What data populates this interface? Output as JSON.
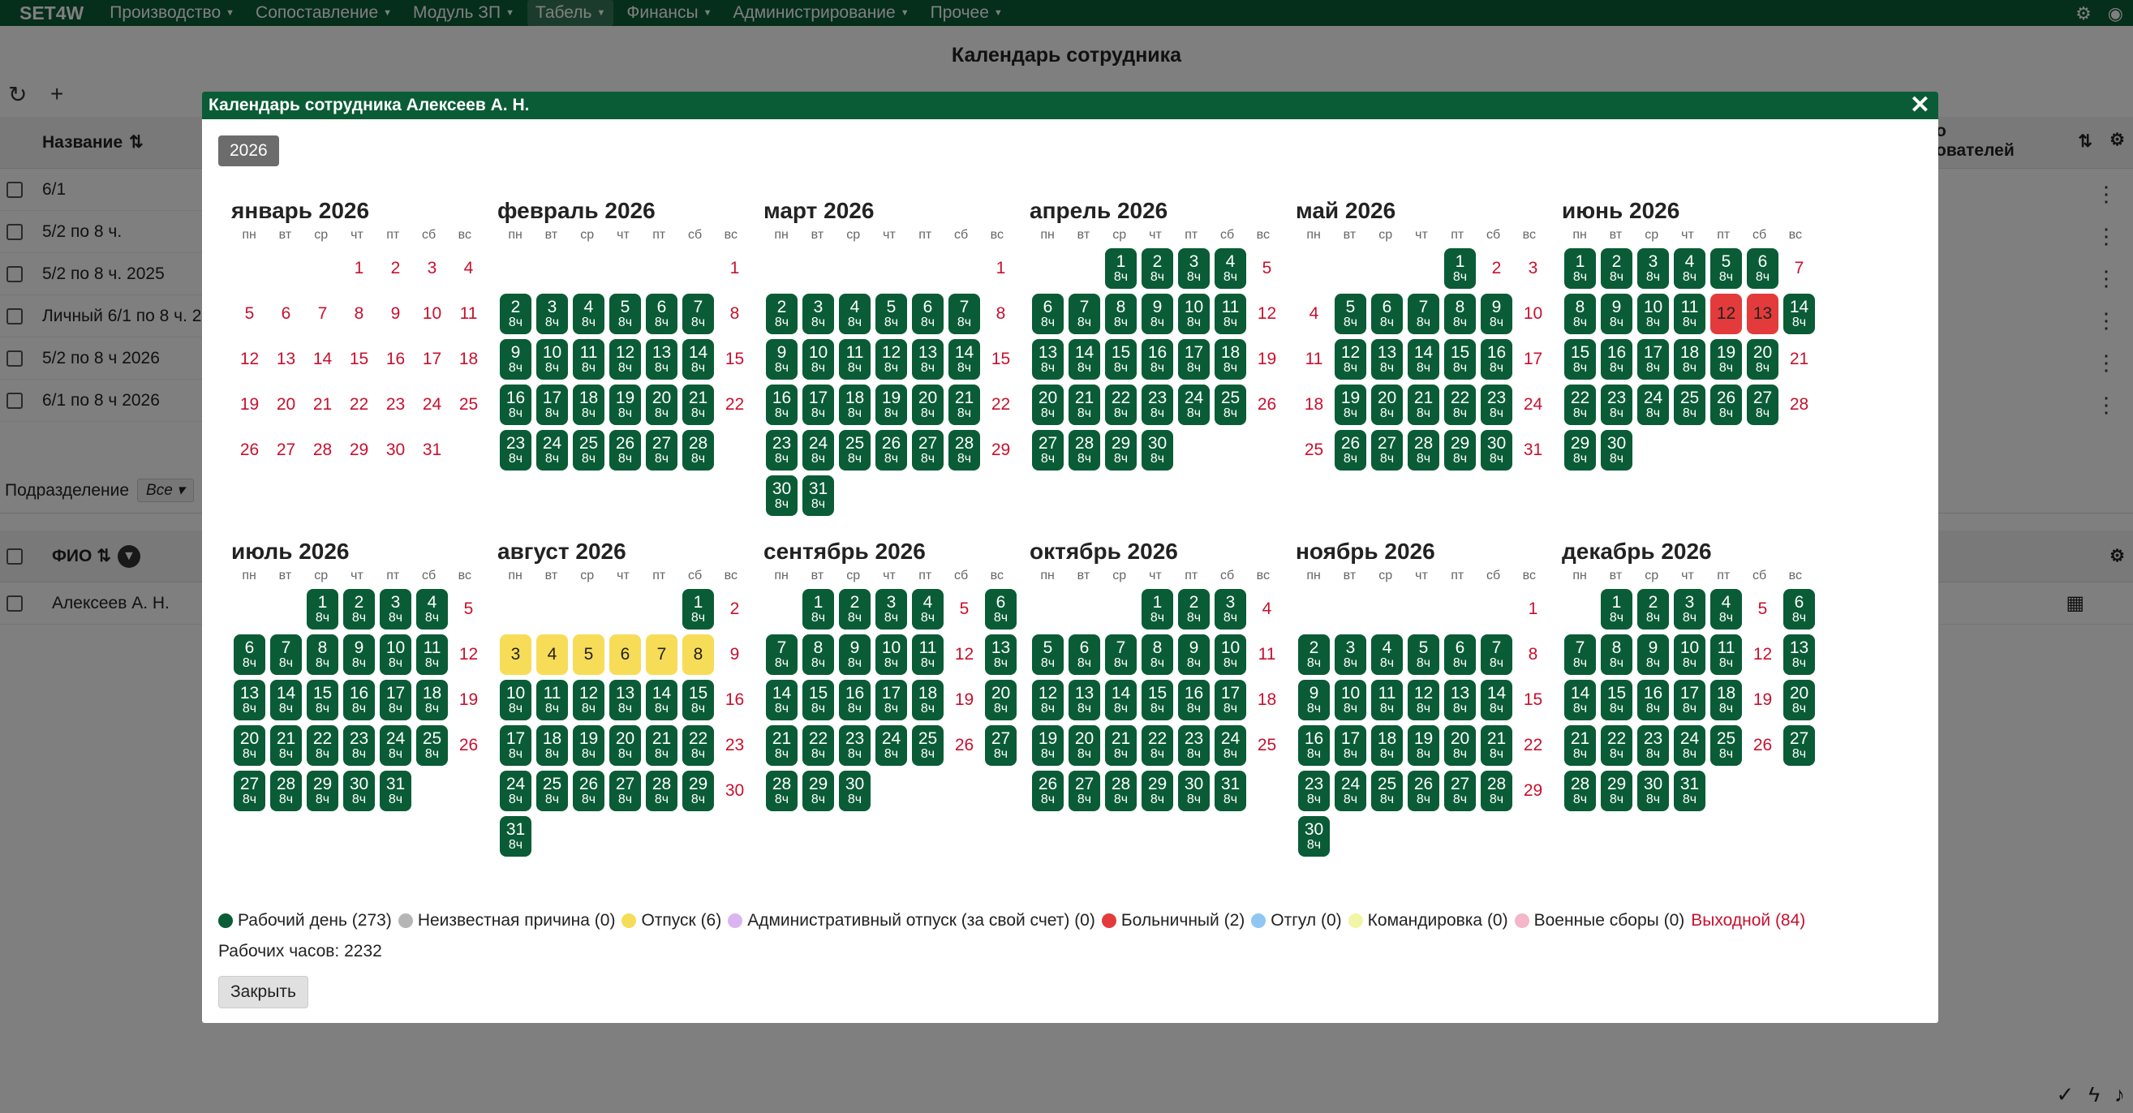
{
  "topbar": {
    "brand": "SET4W",
    "menus": [
      "Производство",
      "Сопоставление",
      "Модуль ЗП",
      "Табель",
      "Финансы",
      "Администрирование",
      "Прочее"
    ],
    "active_menu": "Табель"
  },
  "page": {
    "title": "Календарь сотрудника",
    "list_header": "Название",
    "list_items": [
      "6/1",
      "5/2 по 8 ч.",
      "5/2 по 8 ч. 2025",
      "Личный 6/1 по 8 ч. 2026",
      "5/2 по 8 ч 2026",
      "6/1 по 8 ч 2026"
    ],
    "right_header": "о\nователей",
    "filter_label": "Подразделение",
    "filter_value": "Все",
    "emp_header": "ФИО",
    "emp_rows": [
      "Алексеев А. Н."
    ]
  },
  "modal": {
    "title": "Календарь сотрудника Алексеев А. Н.",
    "year": "2026",
    "weekdays": [
      "пн",
      "вт",
      "ср",
      "чт",
      "пт",
      "сб",
      "вс"
    ],
    "hours_label": "8ч",
    "months": [
      {
        "name": "январь 2026",
        "offset": 3,
        "days": 31,
        "codes": "ooooooooooooooooooooooooooooooo"
      },
      {
        "name": "февраль 2026",
        "offset": 6,
        "days": 28,
        "codes": "owwwwwwowwwwwwowwwwwwowwwwwwo"
      },
      {
        "name": "март 2026",
        "offset": 6,
        "days": 31,
        "codes": "owwwwwwowwwwwwowwwwwwowwwwwwoww"
      },
      {
        "name": "апрель 2026",
        "offset": 2,
        "days": 30,
        "codes": "wwwwowwwwwwowwwwwwowwwwwwowwww"
      },
      {
        "name": "май 2026",
        "offset": 4,
        "days": 31,
        "codes": "wooowwwwwoowwwwwoowwwwwoowwwwwoo"
      },
      {
        "name": "июнь 2026",
        "offset": 0,
        "days": 30,
        "codes": "wwwwwwowwwwsswwwwwwwowwwwwwoww"
      },
      {
        "name": "июль 2026",
        "offset": 2,
        "days": 31,
        "codes": "wwwwowwwwwwowwwwwwowwwwwwowwwww"
      },
      {
        "name": "август 2026",
        "offset": 5,
        "days": 31,
        "codes": "wovvvvvvowwwwwwowwwwwwowwwwwwow"
      },
      {
        "name": "сентябрь 2026",
        "offset": 1,
        "days": 30,
        "codes": "wwwwowwwwwwowwwwwwowwwwwwowwww"
      },
      {
        "name": "октябрь 2026",
        "offset": 3,
        "days": 31,
        "codes": "wwwowwwwwwowwwwwwowwwwwwowwwwww"
      },
      {
        "name": "ноябрь 2026",
        "offset": 6,
        "days": 30,
        "codes": "owwwwwwowwwwwwowwwwwwowwwwwwow"
      },
      {
        "name": "декабрь 2026",
        "offset": 1,
        "days": 31,
        "codes": "wwwwowwwwwwowwwwwwowwwwwwowwwww"
      }
    ],
    "legend": [
      {
        "label": "Рабочий день (273)",
        "color": "#0a5c36"
      },
      {
        "label": "Неизвестная причина (0)",
        "color": "#b5b5b5"
      },
      {
        "label": "Отпуск (6)",
        "color": "#f7dc58"
      },
      {
        "label": "Административный отпуск (за свой счет) (0)",
        "color": "#d9b6f0"
      },
      {
        "label": "Больничный (2)",
        "color": "#e33b3b"
      },
      {
        "label": "Отгул (0)",
        "color": "#8ec7f2"
      },
      {
        "label": "Командировка (0)",
        "color": "#f1f6a6"
      },
      {
        "label": "Военные сборы (0)",
        "color": "#f4b6c9"
      }
    ],
    "legend_off": "Выходной (84)",
    "work_hours": "Рабочих часов: 2232",
    "close_label": "Закрыть"
  }
}
